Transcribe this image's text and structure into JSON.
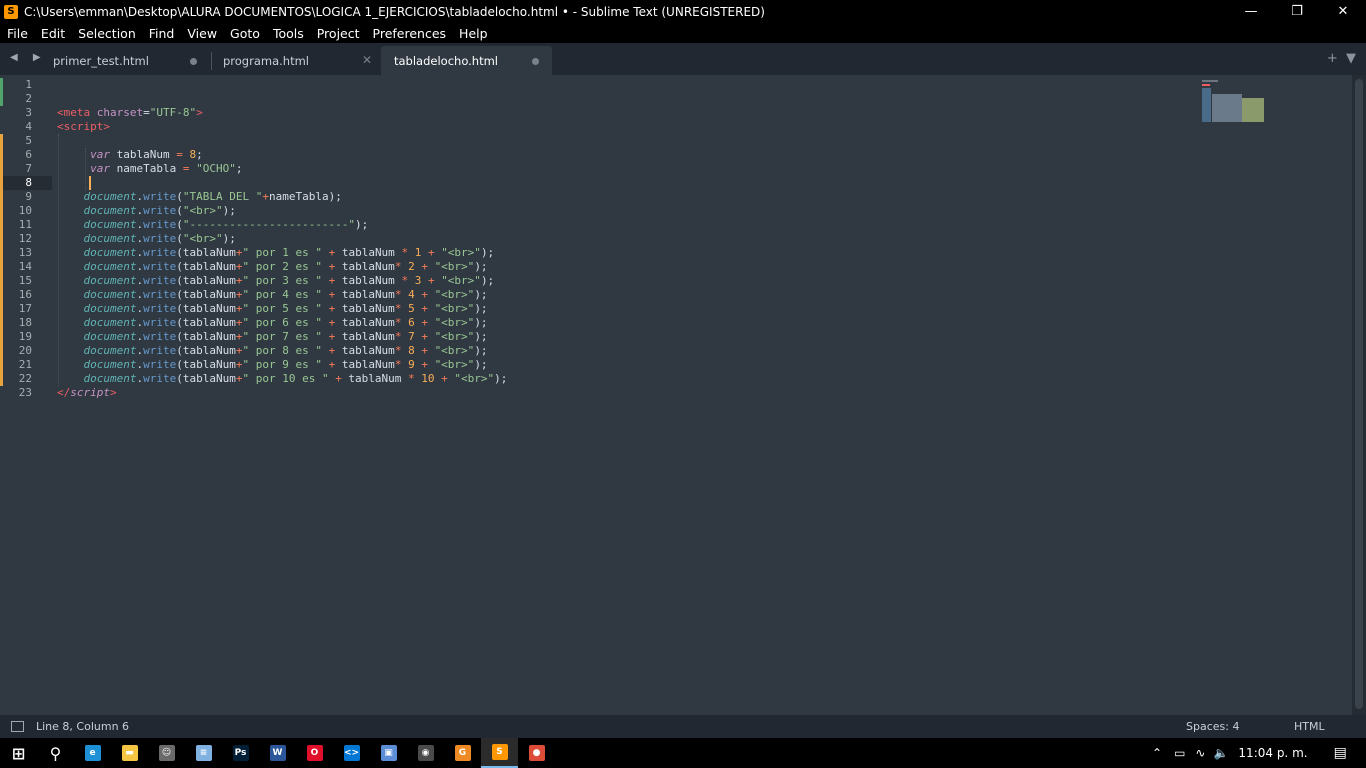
{
  "window": {
    "title": "C:\\Users\\emman\\Desktop\\ALURA DOCUMENTOS\\LOGICA 1_EJERCICIOS\\tabladelocho.html • - Sublime Text (UNREGISTERED)",
    "app_icon": "S"
  },
  "menu": [
    "File",
    "Edit",
    "Selection",
    "Find",
    "View",
    "Goto",
    "Tools",
    "Project",
    "Preferences",
    "Help"
  ],
  "tabs": [
    {
      "label": "primer_test.html",
      "state": "modified"
    },
    {
      "label": "programa.html",
      "state": "close"
    },
    {
      "label": "tabladelocho.html",
      "state": "modified-active"
    }
  ],
  "editor": {
    "current_line": 8,
    "lines": [
      {
        "n": "1",
        "tokens": []
      },
      {
        "n": "2",
        "tokens": []
      },
      {
        "n": "3",
        "tokens": [
          [
            "t",
            "<meta "
          ],
          [
            "a",
            "charset"
          ],
          [
            "p",
            "="
          ],
          [
            "s",
            "\"UTF-8\""
          ],
          [
            "t",
            ">"
          ]
        ]
      },
      {
        "n": "4",
        "tokens": [
          [
            "t",
            "<script>"
          ]
        ]
      },
      {
        "n": "5",
        "tokens": []
      },
      {
        "n": "6",
        "tokens": [
          [
            "p",
            "     "
          ],
          [
            "k",
            "var"
          ],
          [
            "p",
            " tablaNum "
          ],
          [
            "o",
            "="
          ],
          [
            "p",
            " "
          ],
          [
            "n",
            "8"
          ],
          [
            "p",
            ";"
          ]
        ]
      },
      {
        "n": "7",
        "tokens": [
          [
            "p",
            "     "
          ],
          [
            "k",
            "var"
          ],
          [
            "p",
            " nameTabla "
          ],
          [
            "o",
            "="
          ],
          [
            "p",
            " "
          ],
          [
            "s",
            "\"OCHO\""
          ],
          [
            "p",
            ";"
          ]
        ]
      },
      {
        "n": "8",
        "tokens": []
      },
      {
        "n": "9",
        "tokens": [
          [
            "p",
            "    "
          ],
          [
            "d",
            "document"
          ],
          [
            "p",
            "."
          ],
          [
            "f",
            "write"
          ],
          [
            "p",
            "("
          ],
          [
            "s",
            "\"TABLA DEL \""
          ],
          [
            "o",
            "+"
          ],
          [
            "p",
            "nameTabla);"
          ]
        ]
      },
      {
        "n": "10",
        "tokens": [
          [
            "p",
            "    "
          ],
          [
            "d",
            "document"
          ],
          [
            "p",
            "."
          ],
          [
            "f",
            "write"
          ],
          [
            "p",
            "("
          ],
          [
            "s",
            "\"<br>\""
          ],
          [
            "p",
            ");"
          ]
        ]
      },
      {
        "n": "11",
        "tokens": [
          [
            "p",
            "    "
          ],
          [
            "d",
            "document"
          ],
          [
            "p",
            "."
          ],
          [
            "f",
            "write"
          ],
          [
            "p",
            "("
          ],
          [
            "s",
            "\"------------------------\""
          ],
          [
            "p",
            ");"
          ]
        ]
      },
      {
        "n": "12",
        "tokens": [
          [
            "p",
            "    "
          ],
          [
            "d",
            "document"
          ],
          [
            "p",
            "."
          ],
          [
            "f",
            "write"
          ],
          [
            "p",
            "("
          ],
          [
            "s",
            "\"<br>\""
          ],
          [
            "p",
            ");"
          ]
        ]
      },
      {
        "n": "13",
        "tokens": [
          [
            "p",
            "    "
          ],
          [
            "d",
            "document"
          ],
          [
            "p",
            "."
          ],
          [
            "f",
            "write"
          ],
          [
            "p",
            "(tablaNum"
          ],
          [
            "o",
            "+"
          ],
          [
            "s",
            "\" por 1 es \""
          ],
          [
            "p",
            " "
          ],
          [
            "o",
            "+"
          ],
          [
            "p",
            " tablaNum "
          ],
          [
            "o",
            "*"
          ],
          [
            "p",
            " "
          ],
          [
            "n",
            "1"
          ],
          [
            "p",
            " "
          ],
          [
            "o",
            "+"
          ],
          [
            "p",
            " "
          ],
          [
            "s",
            "\"<br>\""
          ],
          [
            "p",
            ");"
          ]
        ]
      },
      {
        "n": "14",
        "tokens": [
          [
            "p",
            "    "
          ],
          [
            "d",
            "document"
          ],
          [
            "p",
            "."
          ],
          [
            "f",
            "write"
          ],
          [
            "p",
            "(tablaNum"
          ],
          [
            "o",
            "+"
          ],
          [
            "s",
            "\" por 2 es \""
          ],
          [
            "p",
            " "
          ],
          [
            "o",
            "+"
          ],
          [
            "p",
            " tablaNum"
          ],
          [
            "o",
            "*"
          ],
          [
            "p",
            " "
          ],
          [
            "n",
            "2"
          ],
          [
            "p",
            " "
          ],
          [
            "o",
            "+"
          ],
          [
            "p",
            " "
          ],
          [
            "s",
            "\"<br>\""
          ],
          [
            "p",
            ");"
          ]
        ]
      },
      {
        "n": "15",
        "tokens": [
          [
            "p",
            "    "
          ],
          [
            "d",
            "document"
          ],
          [
            "p",
            "."
          ],
          [
            "f",
            "write"
          ],
          [
            "p",
            "(tablaNum"
          ],
          [
            "o",
            "+"
          ],
          [
            "s",
            "\" por 3 es \""
          ],
          [
            "p",
            " "
          ],
          [
            "o",
            "+"
          ],
          [
            "p",
            " tablaNum "
          ],
          [
            "o",
            "*"
          ],
          [
            "p",
            " "
          ],
          [
            "n",
            "3"
          ],
          [
            "p",
            " "
          ],
          [
            "o",
            "+"
          ],
          [
            "p",
            " "
          ],
          [
            "s",
            "\"<br>\""
          ],
          [
            "p",
            ");"
          ]
        ]
      },
      {
        "n": "16",
        "tokens": [
          [
            "p",
            "    "
          ],
          [
            "d",
            "document"
          ],
          [
            "p",
            "."
          ],
          [
            "f",
            "write"
          ],
          [
            "p",
            "(tablaNum"
          ],
          [
            "o",
            "+"
          ],
          [
            "s",
            "\" por 4 es \""
          ],
          [
            "p",
            " "
          ],
          [
            "o",
            "+"
          ],
          [
            "p",
            " tablaNum"
          ],
          [
            "o",
            "*"
          ],
          [
            "p",
            " "
          ],
          [
            "n",
            "4"
          ],
          [
            "p",
            " "
          ],
          [
            "o",
            "+"
          ],
          [
            "p",
            " "
          ],
          [
            "s",
            "\"<br>\""
          ],
          [
            "p",
            ");"
          ]
        ]
      },
      {
        "n": "17",
        "tokens": [
          [
            "p",
            "    "
          ],
          [
            "d",
            "document"
          ],
          [
            "p",
            "."
          ],
          [
            "f",
            "write"
          ],
          [
            "p",
            "(tablaNum"
          ],
          [
            "o",
            "+"
          ],
          [
            "s",
            "\" por 5 es \""
          ],
          [
            "p",
            " "
          ],
          [
            "o",
            "+"
          ],
          [
            "p",
            " tablaNum"
          ],
          [
            "o",
            "*"
          ],
          [
            "p",
            " "
          ],
          [
            "n",
            "5"
          ],
          [
            "p",
            " "
          ],
          [
            "o",
            "+"
          ],
          [
            "p",
            " "
          ],
          [
            "s",
            "\"<br>\""
          ],
          [
            "p",
            ");"
          ]
        ]
      },
      {
        "n": "18",
        "tokens": [
          [
            "p",
            "    "
          ],
          [
            "d",
            "document"
          ],
          [
            "p",
            "."
          ],
          [
            "f",
            "write"
          ],
          [
            "p",
            "(tablaNum"
          ],
          [
            "o",
            "+"
          ],
          [
            "s",
            "\" por 6 es \""
          ],
          [
            "p",
            " "
          ],
          [
            "o",
            "+"
          ],
          [
            "p",
            " tablaNum"
          ],
          [
            "o",
            "*"
          ],
          [
            "p",
            " "
          ],
          [
            "n",
            "6"
          ],
          [
            "p",
            " "
          ],
          [
            "o",
            "+"
          ],
          [
            "p",
            " "
          ],
          [
            "s",
            "\"<br>\""
          ],
          [
            "p",
            ");"
          ]
        ]
      },
      {
        "n": "19",
        "tokens": [
          [
            "p",
            "    "
          ],
          [
            "d",
            "document"
          ],
          [
            "p",
            "."
          ],
          [
            "f",
            "write"
          ],
          [
            "p",
            "(tablaNum"
          ],
          [
            "o",
            "+"
          ],
          [
            "s",
            "\" por 7 es \""
          ],
          [
            "p",
            " "
          ],
          [
            "o",
            "+"
          ],
          [
            "p",
            " tablaNum"
          ],
          [
            "o",
            "*"
          ],
          [
            "p",
            " "
          ],
          [
            "n",
            "7"
          ],
          [
            "p",
            " "
          ],
          [
            "o",
            "+"
          ],
          [
            "p",
            " "
          ],
          [
            "s",
            "\"<br>\""
          ],
          [
            "p",
            ");"
          ]
        ]
      },
      {
        "n": "20",
        "tokens": [
          [
            "p",
            "    "
          ],
          [
            "d",
            "document"
          ],
          [
            "p",
            "."
          ],
          [
            "f",
            "write"
          ],
          [
            "p",
            "(tablaNum"
          ],
          [
            "o",
            "+"
          ],
          [
            "s",
            "\" por 8 es \""
          ],
          [
            "p",
            " "
          ],
          [
            "o",
            "+"
          ],
          [
            "p",
            " tablaNum"
          ],
          [
            "o",
            "*"
          ],
          [
            "p",
            " "
          ],
          [
            "n",
            "8"
          ],
          [
            "p",
            " "
          ],
          [
            "o",
            "+"
          ],
          [
            "p",
            " "
          ],
          [
            "s",
            "\"<br>\""
          ],
          [
            "p",
            ");"
          ]
        ]
      },
      {
        "n": "21",
        "tokens": [
          [
            "p",
            "    "
          ],
          [
            "d",
            "document"
          ],
          [
            "p",
            "."
          ],
          [
            "f",
            "write"
          ],
          [
            "p",
            "(tablaNum"
          ],
          [
            "o",
            "+"
          ],
          [
            "s",
            "\" por 9 es \""
          ],
          [
            "p",
            " "
          ],
          [
            "o",
            "+"
          ],
          [
            "p",
            " tablaNum"
          ],
          [
            "o",
            "*"
          ],
          [
            "p",
            " "
          ],
          [
            "n",
            "9"
          ],
          [
            "p",
            " "
          ],
          [
            "o",
            "+"
          ],
          [
            "p",
            " "
          ],
          [
            "s",
            "\"<br>\""
          ],
          [
            "p",
            ");"
          ]
        ]
      },
      {
        "n": "22",
        "tokens": [
          [
            "p",
            "    "
          ],
          [
            "d",
            "document"
          ],
          [
            "p",
            "."
          ],
          [
            "f",
            "write"
          ],
          [
            "p",
            "(tablaNum"
          ],
          [
            "o",
            "+"
          ],
          [
            "s",
            "\" por 10 es \""
          ],
          [
            "p",
            " "
          ],
          [
            "o",
            "+"
          ],
          [
            "p",
            " tablaNum "
          ],
          [
            "o",
            "*"
          ],
          [
            "p",
            " "
          ],
          [
            "n",
            "10"
          ],
          [
            "p",
            " "
          ],
          [
            "o",
            "+"
          ],
          [
            "p",
            " "
          ],
          [
            "s",
            "\"<br>\""
          ],
          [
            "p",
            ");"
          ]
        ]
      },
      {
        "n": "23",
        "tokens": [
          [
            "t",
            "</"
          ],
          [
            "k",
            "script"
          ],
          [
            "t",
            ">"
          ]
        ]
      }
    ]
  },
  "status": {
    "position": "Line 8, Column 6",
    "indentation": "Spaces: 4",
    "syntax": "HTML"
  },
  "taskbar": {
    "apps": [
      {
        "name": "start-button",
        "glyph": "⊞"
      },
      {
        "name": "search-icon",
        "glyph": "⚲"
      },
      {
        "name": "edge-icon",
        "glyph": "e",
        "color": "#1e90d6"
      },
      {
        "name": "file-explorer-icon",
        "glyph": "▬",
        "color": "#f4c542"
      },
      {
        "name": "emoji-app-icon",
        "glyph": "☺",
        "color": "#6a6a6a"
      },
      {
        "name": "notepad-icon",
        "glyph": "≡",
        "color": "#7fb2e0"
      },
      {
        "name": "photoshop-icon",
        "glyph": "Ps",
        "color": "#001e36"
      },
      {
        "name": "word-icon",
        "glyph": "W",
        "color": "#2b579a"
      },
      {
        "name": "opera-icon",
        "glyph": "O",
        "color": "#e0102a"
      },
      {
        "name": "vscode-icon",
        "glyph": "<>",
        "color": "#0078d4"
      },
      {
        "name": "virtualbox-icon",
        "glyph": "▣",
        "color": "#5b8ed6"
      },
      {
        "name": "obs-icon",
        "glyph": "◉",
        "color": "#4a4a4a"
      },
      {
        "name": "orange-app-icon",
        "glyph": "G",
        "color": "#f08a24"
      },
      {
        "name": "sublime-text-icon",
        "glyph": "S",
        "color": "#ff9800"
      },
      {
        "name": "chrome-icon",
        "glyph": "●",
        "color": "#dd4b39"
      }
    ],
    "clock": "11:04 p. m."
  },
  "colors": {
    "editor_bg": "#303841",
    "modified_marker": "#e8a33d",
    "added_marker": "#4fa36b"
  }
}
